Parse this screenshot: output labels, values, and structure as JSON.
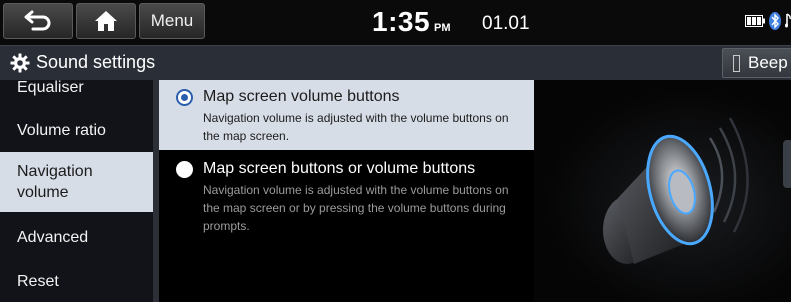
{
  "status_bar": {
    "back_label": "back",
    "home_label": "home",
    "menu_label": "Menu",
    "time": "1:35",
    "ampm": "PM",
    "date": "01.01",
    "battery_icon": "battery-icon",
    "bluetooth_icon": "bluetooth-icon",
    "music_icon": "music-note-icon"
  },
  "title_bar": {
    "title": "Sound settings",
    "icon": "gear-icon",
    "beep_label": "Beep"
  },
  "sidebar": {
    "items": [
      {
        "label": "Equaliser"
      },
      {
        "label": "Volume ratio"
      },
      {
        "label": "Navigation volume",
        "selected": true
      },
      {
        "label": "Advanced"
      },
      {
        "label": "Reset"
      }
    ]
  },
  "options": [
    {
      "title": "Map screen volume buttons",
      "description": "Navigation volume is adjusted with the volume buttons on the map screen.",
      "selected": true
    },
    {
      "title": "Map screen buttons or volume buttons",
      "description": "Navigation volume is adjusted with the volume buttons on the map screen or by pressing the volume buttons during prompts.",
      "selected": false
    }
  ],
  "colors": {
    "selected_bg": "#d7dde7",
    "radio_accent": "#2b5fae",
    "speaker_glow": "#4aa8ff"
  }
}
